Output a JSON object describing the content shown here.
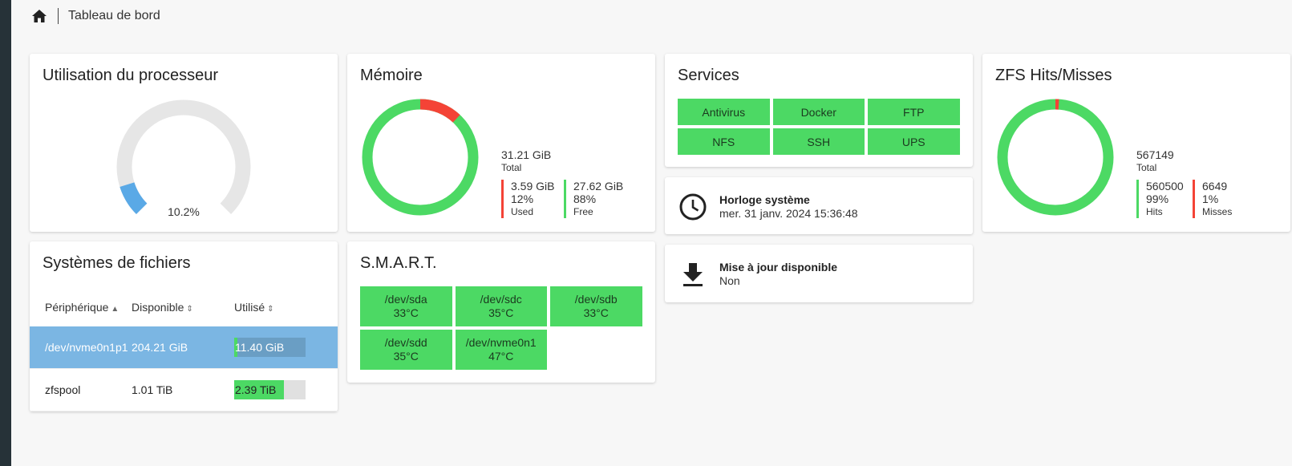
{
  "breadcrumb": {
    "home_icon": "home-icon",
    "current": "Tableau de bord"
  },
  "colors": {
    "green": "#4cd964",
    "red": "#f44336",
    "blue": "#5aa9e6",
    "track": "#e6e6e6",
    "selected_row": "#7bb6e3"
  },
  "cpu": {
    "title": "Utilisation du processeur",
    "value_label": "10.2%",
    "value": 10.2
  },
  "memory": {
    "title": "Mémoire",
    "total_value": "31.21 GiB",
    "total_label": "Total",
    "used": {
      "value": "3.59 GiB",
      "percent": "12%",
      "label": "Used",
      "fraction": 0.12
    },
    "free": {
      "value": "27.62 GiB",
      "percent": "88%",
      "label": "Free",
      "fraction": 0.88
    }
  },
  "services": {
    "title": "Services",
    "items": [
      {
        "label": "Antivirus"
      },
      {
        "label": "Docker"
      },
      {
        "label": "FTP"
      },
      {
        "label": "NFS"
      },
      {
        "label": "SSH"
      },
      {
        "label": "UPS"
      }
    ]
  },
  "zfs": {
    "title": "ZFS Hits/Misses",
    "total_value": "567149",
    "total_label": "Total",
    "hits": {
      "value": "560500",
      "percent": "99%",
      "label": "Hits",
      "fraction": 0.99
    },
    "misses": {
      "value": "6649",
      "percent": "1%",
      "label": "Misses",
      "fraction": 0.01
    }
  },
  "clock": {
    "icon": "clock-icon",
    "title": "Horloge système",
    "value": "mer. 31 janv. 2024 15:36:48"
  },
  "update": {
    "icon": "download-icon",
    "title": "Mise à jour disponible",
    "value": "Non"
  },
  "filesystems": {
    "title": "Systèmes de fichiers",
    "columns": [
      {
        "label": "Périphérique",
        "sort": "▲"
      },
      {
        "label": "Disponible",
        "sort": "⇕"
      },
      {
        "label": "Utilisé",
        "sort": "⇕"
      }
    ],
    "rows": [
      {
        "device": "/dev/nvme0n1p1",
        "available": "204.21 GiB",
        "used": "11.40 GiB",
        "used_fraction": 0.05,
        "selected": true
      },
      {
        "device": "zfspool",
        "available": "1.01 TiB",
        "used": "2.39 TiB",
        "used_fraction": 0.7,
        "selected": false
      }
    ]
  },
  "smart": {
    "title": "S.M.A.R.T.",
    "drives": [
      {
        "device": "/dev/sda",
        "temp": "33°C"
      },
      {
        "device": "/dev/sdc",
        "temp": "35°C"
      },
      {
        "device": "/dev/sdb",
        "temp": "33°C"
      },
      {
        "device": "/dev/sdd",
        "temp": "35°C"
      },
      {
        "device": "/dev/nvme0n1",
        "temp": "47°C"
      }
    ]
  }
}
